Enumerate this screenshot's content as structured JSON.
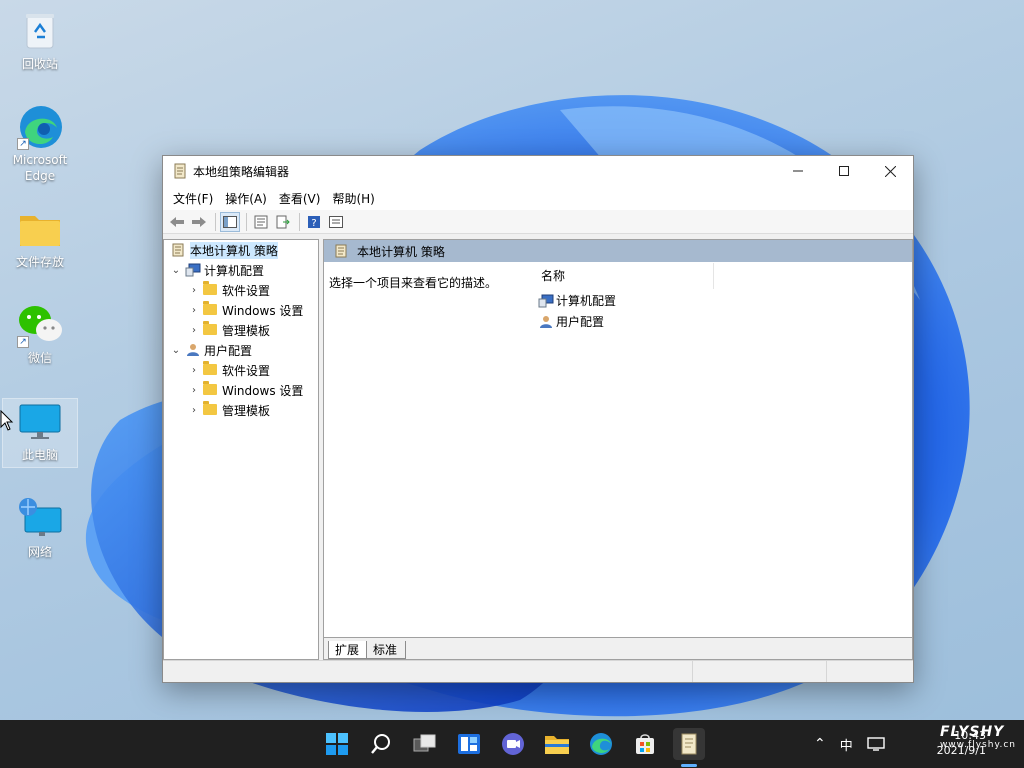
{
  "desktop": {
    "icons": [
      {
        "label": "回收站"
      },
      {
        "label": "Microsoft Edge"
      },
      {
        "label": "文件存放"
      },
      {
        "label": "微信"
      },
      {
        "label": "此电脑"
      },
      {
        "label": "网络"
      }
    ]
  },
  "window": {
    "title": "本地组策略编辑器",
    "menu": [
      "文件(F)",
      "操作(A)",
      "查看(V)",
      "帮助(H)"
    ],
    "tree": {
      "root": "本地计算机 策略",
      "computer": "计算机配置",
      "computer_children": [
        "软件设置",
        "Windows 设置",
        "管理模板"
      ],
      "user": "用户配置",
      "user_children": [
        "软件设置",
        "Windows 设置",
        "管理模板"
      ]
    },
    "right": {
      "header": "本地计算机 策略",
      "description": "选择一个项目来查看它的描述。",
      "column_name": "名称",
      "items": [
        "计算机配置",
        "用户配置"
      ]
    },
    "tabs": [
      "扩展",
      "标准"
    ]
  },
  "taskbar": {
    "ime": "中",
    "clock_time": "10:43",
    "clock_date": "2021/9/1",
    "watermark": "FLYSHY",
    "watermark_sub": "www.flyshy.cn"
  },
  "colors": {
    "taskbar_bg": "#202020",
    "header_band": "#a6b9cf",
    "selection": "#cce8ff",
    "folder": "#f3c742"
  }
}
